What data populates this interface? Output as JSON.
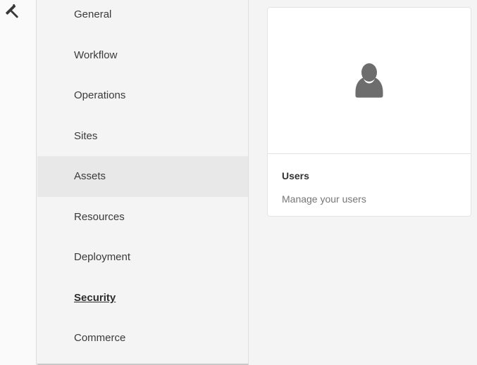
{
  "rail": {
    "tool_icon": "hammer-icon"
  },
  "sidebar": {
    "items": [
      {
        "label": "General",
        "state": "normal"
      },
      {
        "label": "Workflow",
        "state": "normal"
      },
      {
        "label": "Operations",
        "state": "normal"
      },
      {
        "label": "Sites",
        "state": "normal"
      },
      {
        "label": "Assets",
        "state": "selected"
      },
      {
        "label": "Resources",
        "state": "normal"
      },
      {
        "label": "Deployment",
        "state": "normal"
      },
      {
        "label": "Security",
        "state": "focused-underlined"
      },
      {
        "label": "Commerce",
        "state": "normal"
      }
    ]
  },
  "main": {
    "card": {
      "title": "Users",
      "description": "Manage your users",
      "icon": "user-icon"
    }
  },
  "colors": {
    "rail_bg": "#fafafa",
    "menu_bg": "#f4f4f5",
    "selected_row_bg": "#e8e8e8",
    "content_bg": "#f4f4f4",
    "card_bg": "#ffffff",
    "divider": "#dcdcdc",
    "text_primary": "#323232",
    "text_secondary": "#767676",
    "user_icon_gray": "#6d6d6d",
    "hammer_icon_dark": "#383838"
  }
}
